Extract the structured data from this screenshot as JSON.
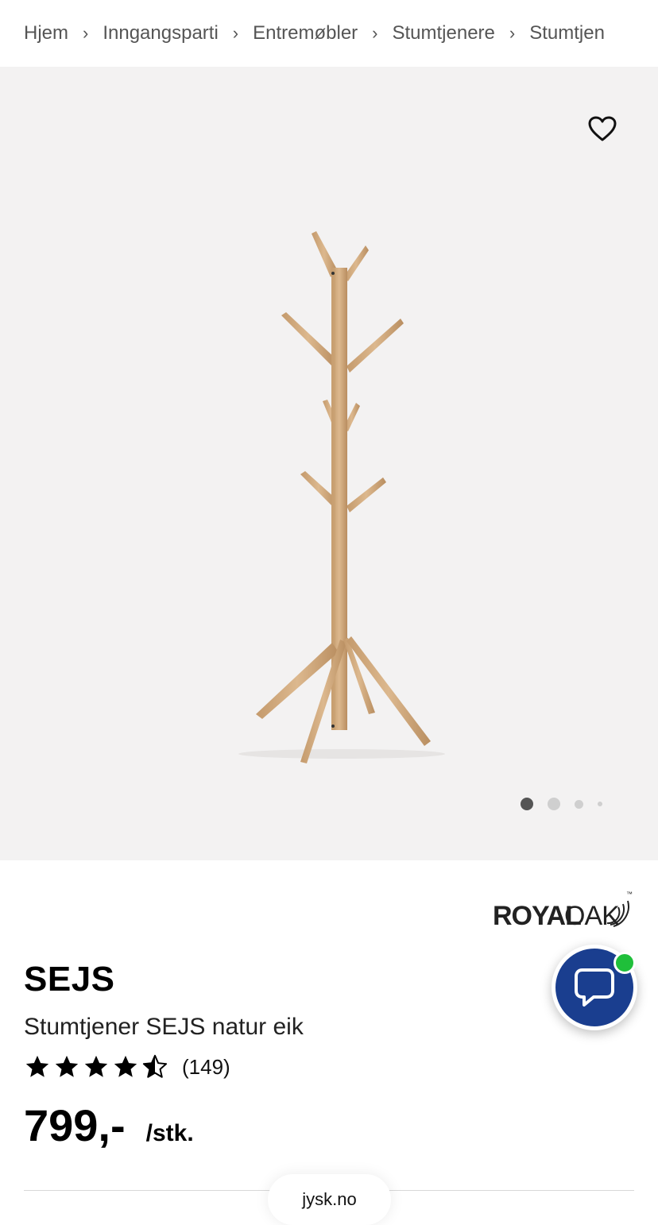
{
  "breadcrumb": {
    "items": [
      "Hjem",
      "Inngangsparti",
      "Entremøbler",
      "Stumtjenere",
      "Stumtjen"
    ],
    "separator": "›"
  },
  "gallery": {
    "favorite_icon": "heart-outline-icon",
    "image_count": 4,
    "active_index": 0
  },
  "brand": {
    "name": "ROYAL OAK",
    "logo_text_bold": "ROYAL",
    "logo_text_light": "OAK",
    "tm": "™"
  },
  "product": {
    "name": "SEJS",
    "description": "Stumtjener SEJS natur eik",
    "rating": 4.5,
    "rating_max": 5,
    "review_count": "(149)",
    "price": "799,-",
    "unit": "/stk."
  },
  "chat": {
    "icon": "chat-bubble-icon",
    "online": true,
    "status_color": "#1fbf3a",
    "button_color": "#1a3e8f"
  },
  "browser": {
    "url": "jysk.no"
  }
}
